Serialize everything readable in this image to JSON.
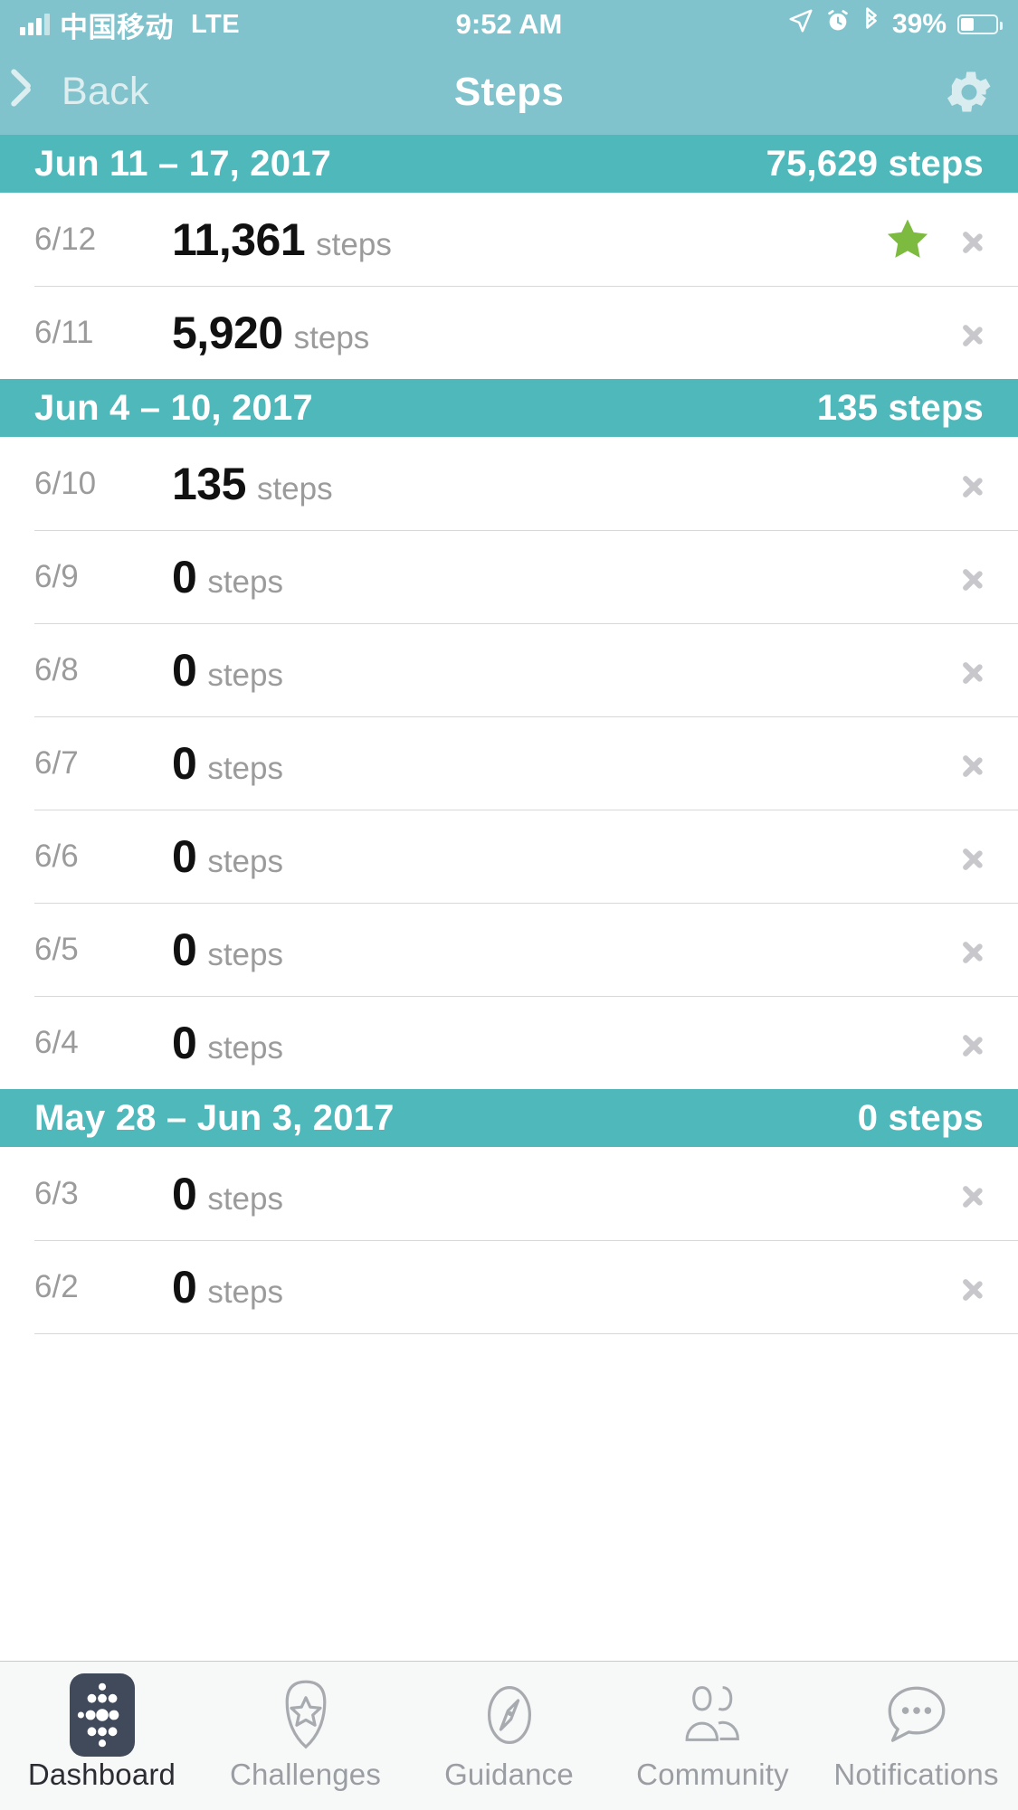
{
  "status_bar": {
    "carrier": "中国移动",
    "network": "LTE",
    "time": "9:52 AM",
    "battery_percent": "39%",
    "battery_level": 39,
    "icons": [
      "signal-bars-icon",
      "location-arrow-icon",
      "alarm-clock-icon",
      "bluetooth-icon",
      "battery-icon"
    ]
  },
  "nav": {
    "back_label": "Back",
    "title": "Steps",
    "settings_icon": "gear-icon"
  },
  "theme": {
    "navbar_teal": "#80C3CC",
    "section_teal": "#4FB8BA",
    "star_green": "#7CBB3F",
    "chevron_gray": "#C7C7CC",
    "date_gray": "#9B9B9B",
    "count_black": "#111111",
    "tabbar_bg": "#F7F8F8",
    "active_tab_navy": "#414A5B"
  },
  "sections": [
    {
      "range": "Jun 11 – 17, 2017",
      "total": "75,629 steps",
      "days": [
        {
          "date": "6/12",
          "count": "11,361",
          "unit": "steps",
          "starred": true
        },
        {
          "date": "6/11",
          "count": "5,920",
          "unit": "steps",
          "starred": false
        }
      ]
    },
    {
      "range": "Jun 4 – 10, 2017",
      "total": "135 steps",
      "days": [
        {
          "date": "6/10",
          "count": "135",
          "unit": "steps",
          "starred": false
        },
        {
          "date": "6/9",
          "count": "0",
          "unit": "steps",
          "starred": false
        },
        {
          "date": "6/8",
          "count": "0",
          "unit": "steps",
          "starred": false
        },
        {
          "date": "6/7",
          "count": "0",
          "unit": "steps",
          "starred": false
        },
        {
          "date": "6/6",
          "count": "0",
          "unit": "steps",
          "starred": false
        },
        {
          "date": "6/5",
          "count": "0",
          "unit": "steps",
          "starred": false
        },
        {
          "date": "6/4",
          "count": "0",
          "unit": "steps",
          "starred": false
        }
      ]
    },
    {
      "range": "May 28 – Jun 3, 2017",
      "total": "0 steps",
      "days": [
        {
          "date": "6/3",
          "count": "0",
          "unit": "steps",
          "starred": false
        },
        {
          "date": "6/2",
          "count": "0",
          "unit": "steps",
          "starred": false
        }
      ]
    }
  ],
  "tabs": [
    {
      "label": "Dashboard",
      "icon": "fitbit-dots-icon",
      "active": true
    },
    {
      "label": "Challenges",
      "icon": "star-shield-icon",
      "active": false
    },
    {
      "label": "Guidance",
      "icon": "compass-icon",
      "active": false
    },
    {
      "label": "Community",
      "icon": "two-people-icon",
      "active": false
    },
    {
      "label": "Notifications",
      "icon": "speech-bubble-icon",
      "active": false
    }
  ]
}
